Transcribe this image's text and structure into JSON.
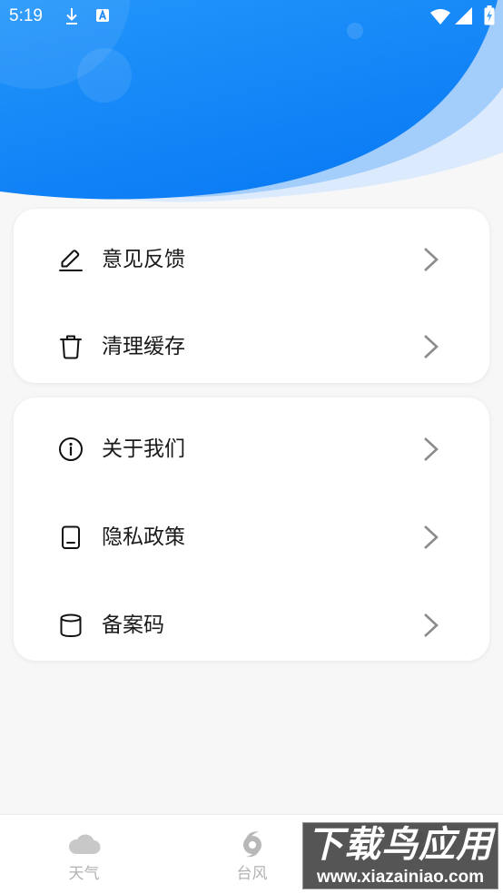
{
  "status_bar": {
    "time": "5:19",
    "left_icons": [
      "download-icon",
      "app-notification-icon"
    ],
    "right_icons": [
      "wifi-icon",
      "cellular-signal-icon",
      "battery-charging-icon"
    ]
  },
  "settings": {
    "groups": [
      {
        "items": [
          {
            "label": "意见反馈",
            "icon": "edit-icon"
          },
          {
            "label": "清理缓存",
            "icon": "trash-icon"
          }
        ]
      },
      {
        "items": [
          {
            "label": "关于我们",
            "icon": "info-icon"
          },
          {
            "label": "隐私政策",
            "icon": "document-icon"
          },
          {
            "label": "备案码",
            "icon": "database-icon"
          }
        ]
      }
    ]
  },
  "bottom_nav": {
    "items": [
      {
        "label": "天气",
        "icon": "cloud-icon"
      },
      {
        "label": "台风",
        "icon": "typhoon-icon"
      },
      {
        "icon": "person-icon"
      }
    ]
  },
  "watermark": {
    "title": "下载鸟应用",
    "url": "www.xiazainiao.com"
  },
  "colors": {
    "header_blue": "#1487f7",
    "header_wave_light": "#a3cdfb",
    "header_wave_lightest": "#dceafd",
    "page_background": "#f7f7f7",
    "card_background": "#ffffff",
    "text": "#1a1a1a",
    "chevron": "#8c8c8c",
    "nav_inactive": "#b2b2b2"
  }
}
